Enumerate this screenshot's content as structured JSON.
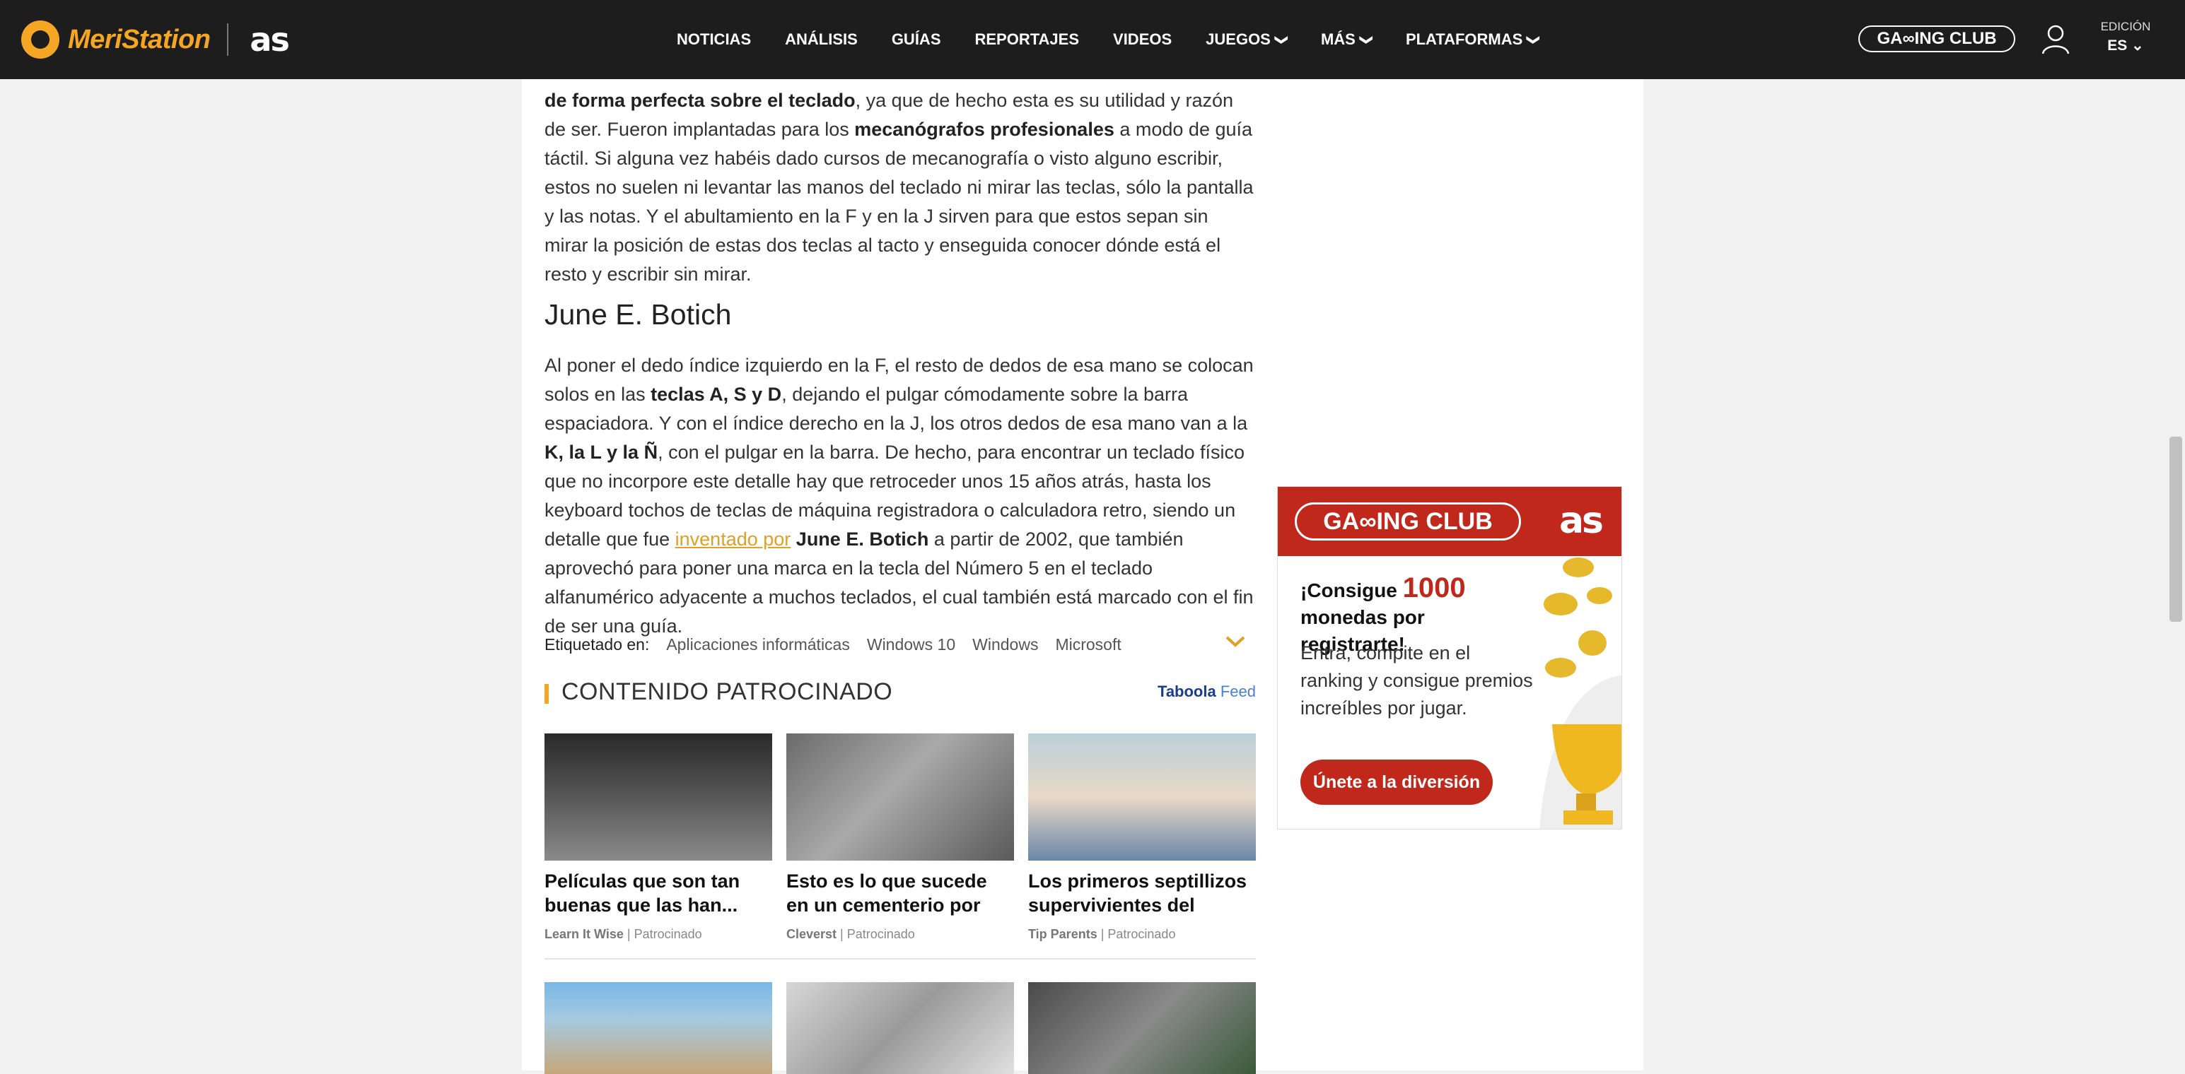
{
  "header": {
    "brand": "MeriStation",
    "partner": "as",
    "nav": [
      {
        "label": "NOTICIAS",
        "dropdown": false
      },
      {
        "label": "ANÁLISIS",
        "dropdown": false
      },
      {
        "label": "GUÍAS",
        "dropdown": false
      },
      {
        "label": "REPORTAJES",
        "dropdown": false
      },
      {
        "label": "VIDEOS",
        "dropdown": false
      },
      {
        "label": "JUEGOS",
        "dropdown": true
      },
      {
        "label": "MÁS",
        "dropdown": true
      },
      {
        "label": "PLATAFORMAS",
        "dropdown": true
      }
    ],
    "gaming_club": "GA∞ING CLUB",
    "edition_label": "EDICIÓN",
    "edition_value": "ES"
  },
  "article": {
    "p1": {
      "s1": "de forma perfecta sobre el teclado",
      "s2": ", ya que de hecho esta es su utilidad y razón de ser. Fueron implantadas para los ",
      "s3": "mecanógrafos profesionales",
      "s4": " a modo de guía táctil. Si alguna vez habéis dado cursos de mecanografía o visto alguno escribir, estos no suelen ni levantar las manos del teclado ni mirar las teclas, sólo la pantalla y las notas. Y el abultamiento en la F y en la J sirven para que estos sepan sin mirar la posición de estas dos teclas al tacto y enseguida conocer dónde está el resto y escribir sin mirar."
    },
    "heading": "June E. Botich",
    "p2": {
      "s1": "Al poner el dedo índice izquierdo en la F, el resto de dedos de esa mano se colocan solos en las ",
      "s2": "teclas A, S y D",
      "s3": ", dejando el pulgar cómodamente sobre la barra espaciadora. Y con el índice derecho en la J, los otros dedos de esa mano van a la ",
      "s4": "K, la L y la Ñ",
      "s5": ", con el pulgar en la barra. De hecho, para encontrar un teclado físico que no incorpore este detalle hay que retroceder unos 15 años atrás, hasta los keyboard tochos de teclas de máquina registradora o calculadora retro, siendo un detalle que fue ",
      "link": "inventado por",
      "s6": " ",
      "s7": "June E. Botich",
      "s8": " a partir de 2002, que también aprovechó para poner una marca en la tecla del Número 5 en el teclado alfanumérico adyacente a muchos teclados, el cual también está marcado con el fin de ser una guía."
    },
    "tags_label": "Etiquetado en:",
    "tags": [
      "Aplicaciones informáticas",
      "Windows 10",
      "Windows",
      "Microsoft"
    ]
  },
  "sponsored": {
    "title": "CONTENIDO PATROCINADO",
    "provider": "Taboola",
    "provider_suffix": " Feed",
    "cards": [
      {
        "title": "Películas que son tan buenas que las han...",
        "source": "Learn It Wise",
        "tag": "Patrocinado"
      },
      {
        "title": "Esto es lo que sucede en un cementerio por la...",
        "source": "Cleverst",
        "tag": "Patrocinado"
      },
      {
        "title": "Los primeros septillizos supervivientes del mun...",
        "source": "Tip Parents",
        "tag": "Patrocinado"
      }
    ]
  },
  "ad": {
    "gaming_club": "GA∞ING CLUB",
    "brand": "as",
    "headline_a": "¡Consigue ",
    "headline_num": "1000",
    "headline_b": " monedas por registrarte!",
    "body": "Entra, compite en el ranking y consigue premios increíbles por jugar.",
    "cta": "Únete a la diversión"
  },
  "colors": {
    "header_bg": "#1d1d1d",
    "brand_orange": "#f5a623",
    "link": "#e0a021",
    "ad_red": "#c0281c"
  }
}
